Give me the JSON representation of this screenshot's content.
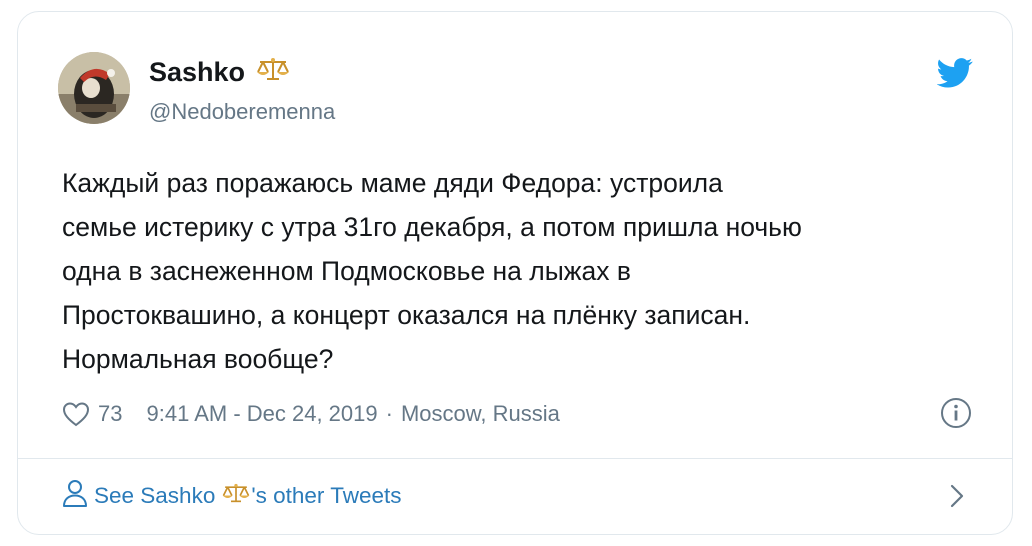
{
  "user": {
    "display_name": "Sashko",
    "handle": "@Nedoberemenna",
    "name_badge_icon": "scales-icon"
  },
  "tweet": {
    "text": "Каждый раз поражаюсь маме дяди Федора: устроила\nсемье истерику с утра 31го декабря, а потом пришла ночью\nодна в заснеженном Подмосковье на лыжах в\nПростоквашино, а концерт оказался на плёнку записан.\nНормальная вообще?"
  },
  "meta": {
    "likes": "73",
    "timestamp": "9:41 AM - Dec 24, 2019",
    "separator": "·",
    "location": "Moscow, Russia"
  },
  "footer": {
    "see_prefix": "See Sashko",
    "see_suffix": "'s other Tweets"
  },
  "icons": {
    "brand": "twitter-bird-icon",
    "like": "heart-icon",
    "info": "info-icon",
    "profile": "person-icon",
    "next": "chevron-right-icon"
  },
  "colors": {
    "twitter_blue": "#1da1f2",
    "link_blue": "#2b7bb9",
    "secondary_text": "#657786",
    "primary_text": "#14171a",
    "border": "#e1e8ed",
    "scales_gold": "#d9a53a"
  }
}
